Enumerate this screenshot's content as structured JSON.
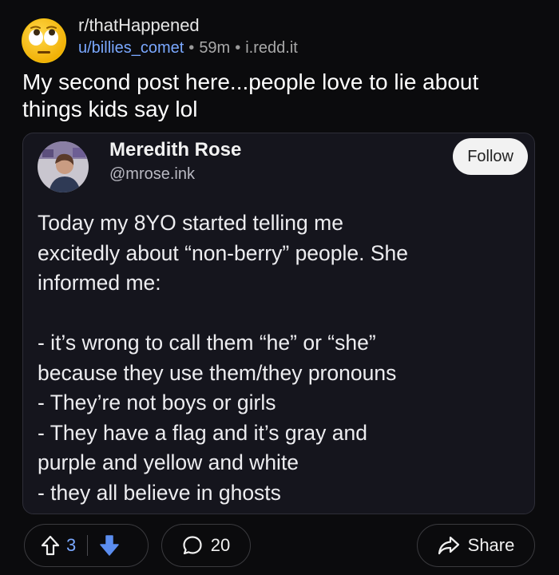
{
  "post": {
    "subreddit": "r/thatHappened",
    "author": "u/billies_comet",
    "age": "59m",
    "domain": "i.redd.it",
    "title": "My second post here...people love to lie about things kids say lol"
  },
  "tweet": {
    "name": "Meredith Rose",
    "handle": "@mrose.ink",
    "follow_label": "Follow",
    "lines": [
      "Today my 8YO started telling me",
      "excitedly about “non-berry” people. She",
      "informed me:",
      "",
      "- it’s wrong to call them “he” or “she”",
      "because they use them/they pronouns",
      "- They’re not boys or girls",
      "- They have a flag and it’s gray and",
      "purple and yellow and white",
      "- they all believe in ghosts"
    ]
  },
  "actions": {
    "upvotes": "3",
    "comments": "20",
    "share_label": "Share"
  },
  "colors": {
    "background": "#0b0b0d",
    "card": "#15151d",
    "username_link": "#7aa8ff",
    "upvote_active": "#7aa8ff",
    "downvote_active": "#5b8def",
    "avatar_face": "#f4c20d"
  },
  "icons": {
    "subreddit_avatar": "rolling-eyes-emoji-icon",
    "upvote": "upvote-arrow-icon",
    "downvote": "downvote-arrow-icon",
    "comment": "comment-bubble-icon",
    "share": "share-arrow-icon"
  }
}
